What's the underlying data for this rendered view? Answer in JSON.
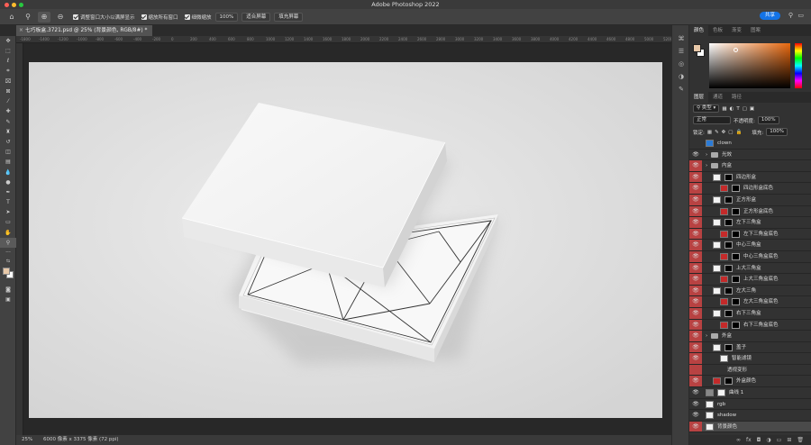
{
  "app": {
    "title": "Adobe Photoshop 2022"
  },
  "options_bar": {
    "resize_windows_label": "调整窗口大小以满屏显示",
    "zoom_all_label": "缩放所有窗口",
    "scrubby_zoom_label": "细微缩放",
    "zoom_100_label": "100%",
    "fit_screen_label": "适合屏幕",
    "fill_screen_label": "填充屏幕",
    "share_label": "共享"
  },
  "document": {
    "tab_title": "七巧板盒.3721.psd @ 25% (背景颜色, RGB/8#) *"
  },
  "ruler": {
    "ticks": [
      "-1800",
      "-1400",
      "-1200",
      "-1000",
      "-800",
      "-600",
      "-400",
      "-200",
      "0",
      "200",
      "400",
      "600",
      "800",
      "1000",
      "1200",
      "1400",
      "1600",
      "1800",
      "2000",
      "2200",
      "2400",
      "2600",
      "2800",
      "3000",
      "3200",
      "3400",
      "3600",
      "3800",
      "4000",
      "4200",
      "4400",
      "4600",
      "4800",
      "5000",
      "5200"
    ]
  },
  "status": {
    "zoom": "25%",
    "doc_info": "6000 像素 x 3375 像素 (72 ppi)"
  },
  "color_panel": {
    "tabs": [
      "颜色",
      "色板",
      "渐变",
      "图案"
    ],
    "fg_color": "#e8c8a8",
    "bg_color": "#ffffff"
  },
  "layers_panel": {
    "tabs": [
      "图层",
      "通道",
      "路径"
    ],
    "filter_label": "类型",
    "blend_mode": "正常",
    "opacity_label": "不透明度:",
    "opacity_value": "100%",
    "lock_label": "锁定:",
    "fill_label": "填充:",
    "fill_value": "100%",
    "layers": [
      {
        "name": "clown",
        "kind": "group",
        "indent": 0,
        "red": false,
        "eye": false
      },
      {
        "name": "光效",
        "kind": "folder",
        "indent": 0,
        "red": false,
        "eye": true
      },
      {
        "name": "内盒",
        "kind": "folder",
        "indent": 0,
        "red": true,
        "eye": true
      },
      {
        "name": "四边形盒",
        "kind": "smart",
        "indent": 1,
        "red": true,
        "eye": true
      },
      {
        "name": "四边形盒底色",
        "kind": "fill",
        "indent": 2,
        "red": true,
        "eye": true
      },
      {
        "name": "正方形盒",
        "kind": "smart",
        "indent": 1,
        "red": true,
        "eye": true
      },
      {
        "name": "正方形盒底色",
        "kind": "fill",
        "indent": 2,
        "red": true,
        "eye": true
      },
      {
        "name": "左下三角盒",
        "kind": "smart",
        "indent": 1,
        "red": true,
        "eye": true
      },
      {
        "name": "左下三角盒底色",
        "kind": "fill",
        "indent": 2,
        "red": true,
        "eye": true
      },
      {
        "name": "中心三角盒",
        "kind": "smart",
        "indent": 1,
        "red": true,
        "eye": true
      },
      {
        "name": "中心三角盒底色",
        "kind": "fill",
        "indent": 2,
        "red": true,
        "eye": true
      },
      {
        "name": "上大三角盒",
        "kind": "smart",
        "indent": 1,
        "red": true,
        "eye": true
      },
      {
        "name": "上大三角盒底色",
        "kind": "fill",
        "indent": 2,
        "red": true,
        "eye": true
      },
      {
        "name": "左大三角",
        "kind": "smart",
        "indent": 1,
        "red": true,
        "eye": true
      },
      {
        "name": "左大三角盒底色",
        "kind": "fill",
        "indent": 2,
        "red": true,
        "eye": true
      },
      {
        "name": "右下三角盒",
        "kind": "smart",
        "indent": 1,
        "red": true,
        "eye": true
      },
      {
        "name": "右下三角盒底色",
        "kind": "fill",
        "indent": 2,
        "red": true,
        "eye": true
      },
      {
        "name": "外盒",
        "kind": "folder",
        "indent": 0,
        "red": true,
        "eye": true
      },
      {
        "name": "盖子",
        "kind": "smart",
        "indent": 1,
        "red": true,
        "eye": true
      },
      {
        "name": "智能滤镜",
        "kind": "filter",
        "indent": 2,
        "red": true,
        "eye": true
      },
      {
        "name": "透视变形",
        "kind": "sub",
        "indent": 3,
        "red": true,
        "eye": false
      },
      {
        "name": "外盒颜色",
        "kind": "fill",
        "indent": 1,
        "red": true,
        "eye": true
      },
      {
        "name": "曲线 1",
        "kind": "adjust",
        "indent": 0,
        "red": false,
        "eye": true
      },
      {
        "name": "rgb",
        "kind": "plain",
        "indent": 0,
        "red": false,
        "eye": true
      },
      {
        "name": "shadow",
        "kind": "plain",
        "indent": 0,
        "red": false,
        "eye": true
      },
      {
        "name": "背景颜色",
        "kind": "bg",
        "indent": 0,
        "red": true,
        "eye": true
      }
    ]
  }
}
